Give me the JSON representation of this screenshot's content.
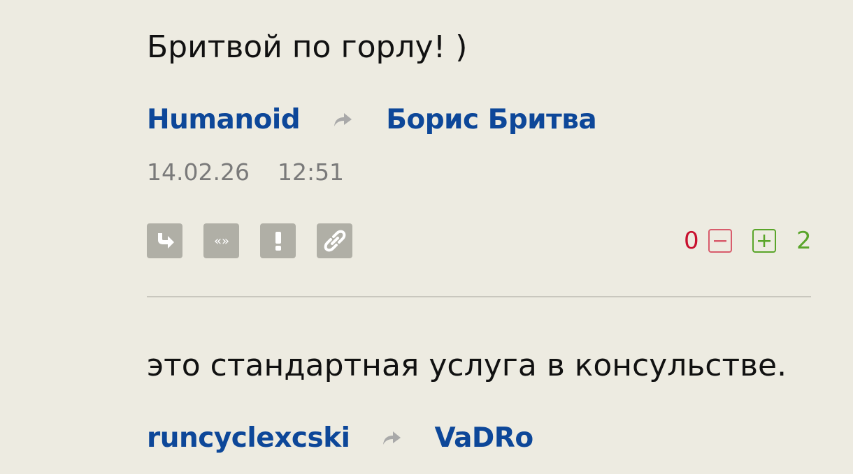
{
  "comments": [
    {
      "text": "Бритвой по горлу! )",
      "author": "Humanoid",
      "reply_to": "Борис Бритва",
      "date": "14.02.26",
      "time": "12:51",
      "votes": {
        "minus": "0",
        "plus": "2"
      },
      "actions": [
        "reply-icon",
        "quote-icon",
        "report-icon",
        "link-icon"
      ]
    },
    {
      "text": "это стандартная услуга в консульстве.",
      "author": "runcyclexcski",
      "reply_to": "VaDRo"
    }
  ],
  "colors": {
    "background": "#edebe1",
    "author_link": "#0d4799",
    "minus": "#c8102e",
    "plus": "#5aa52a",
    "action_button": "#b0afa6"
  }
}
